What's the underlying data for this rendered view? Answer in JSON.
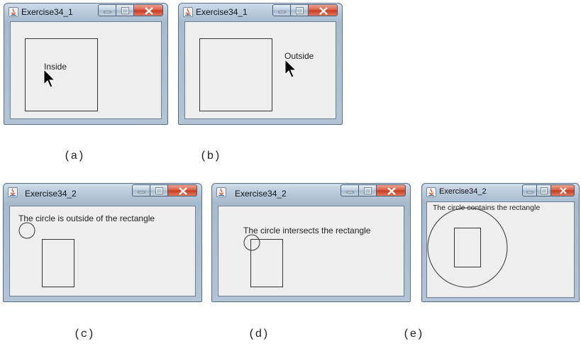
{
  "windows": [
    {
      "id": "a",
      "title": "Exercise34_1",
      "message": "Inside",
      "caption": "(a)"
    },
    {
      "id": "b",
      "title": "Exercise34_1",
      "message": "Outside",
      "caption": "(b)"
    },
    {
      "id": "c",
      "title": "Exercise34_2",
      "message": "The circle is outside of the rectangle",
      "caption": "(c)"
    },
    {
      "id": "d",
      "title": "Exercise34_2",
      "message": "The circle intersects the rectangle",
      "caption": "(d)"
    },
    {
      "id": "e",
      "title": "Exercise34_2",
      "message": "The circle contains the rectangle",
      "caption": "(e)"
    }
  ],
  "icons": {
    "app": "java-icon",
    "minimize": "minimize-icon",
    "maximize": "maximize-icon",
    "close": "close-icon",
    "pointer": "mouse-pointer-icon"
  },
  "colors": {
    "client_background": "#eeeeee",
    "shape_stroke": "#333333",
    "close_button": "#c7381f",
    "title_bar": "#b7c8da"
  }
}
